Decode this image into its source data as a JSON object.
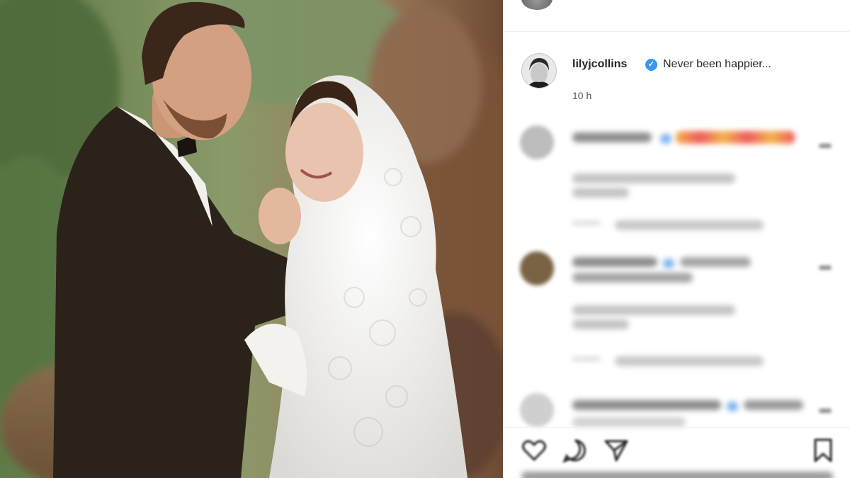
{
  "post": {
    "username": "lilyjcollins",
    "caption": "Never been happier...",
    "timestamp": "10 h",
    "verified": true
  },
  "colors": {
    "verified_badge": "#3897f0",
    "text_primary": "#262626",
    "text_secondary": "#555555",
    "divider": "#efefef"
  },
  "icons": [
    "verified-icon",
    "heart-icon",
    "comment-icon",
    "share-icon",
    "bookmark-icon",
    "more-options-icon"
  ]
}
